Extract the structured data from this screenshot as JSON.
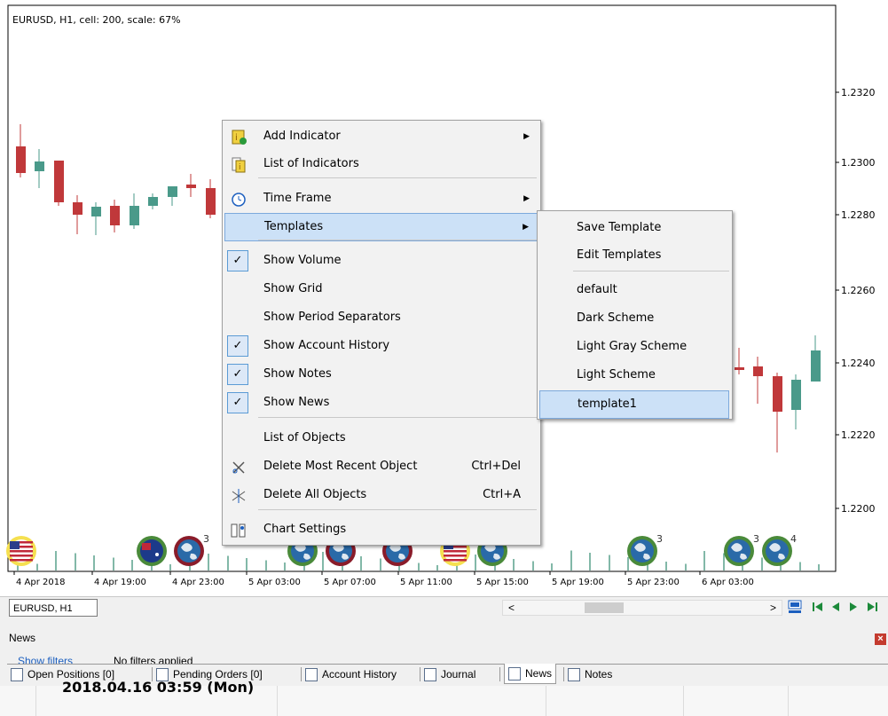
{
  "chart": {
    "info": "EURUSD, H1, cell: 200, scale: 67%",
    "price_labels": [
      "1.2320",
      "1.2300",
      "1.2280",
      "1.2260",
      "1.2240",
      "1.2220",
      "1.2200"
    ],
    "time_labels": [
      "4 Apr 2018",
      "4 Apr 19:00",
      "4 Apr 23:00",
      "5 Apr 03:00",
      "5 Apr 07:00",
      "5 Apr 11:00",
      "5 Apr 15:00",
      "5 Apr 19:00",
      "5 Apr 23:00",
      "6 Apr 03:00"
    ],
    "colors": {
      "bull": "#4a9a8a",
      "bear": "#c0383a"
    },
    "event_icons": [
      "us-flag-icon",
      "au-flag-icon",
      "globe-icon",
      "globe-icon",
      "globe-icon",
      "globe-icon",
      "us-flag-icon",
      "globe-icon",
      "globe-icon",
      "globe-icon",
      "globe-icon"
    ],
    "event_counts": [
      "3",
      "3",
      "3",
      "4",
      "3"
    ]
  },
  "context_menu": {
    "items": [
      {
        "label": "Add Indicator",
        "submenu": true,
        "icon": "add-indicator-icon"
      },
      {
        "label": "List of Indicators",
        "icon": "indicator-list-icon"
      },
      {
        "label": "Time Frame",
        "submenu": true,
        "icon": "clock-icon"
      },
      {
        "label": "Templates",
        "submenu": true,
        "highlighted": true
      },
      {
        "label": "Show Volume",
        "checked": true
      },
      {
        "label": "Show Grid"
      },
      {
        "label": "Show Period Separators"
      },
      {
        "label": "Show Account History",
        "checked": true
      },
      {
        "label": "Show Notes",
        "checked": true
      },
      {
        "label": "Show News",
        "checked": true
      },
      {
        "label": "List of Objects"
      },
      {
        "label": "Delete Most Recent Object",
        "shortcut": "Ctrl+Del",
        "icon": "delete-object-icon"
      },
      {
        "label": "Delete All Objects",
        "shortcut": "Ctrl+A",
        "icon": "delete-all-objects-icon"
      },
      {
        "label": "Chart Settings",
        "icon": "chart-settings-icon"
      }
    ],
    "check_mark": "✓",
    "arrow": "▶"
  },
  "templates_submenu": {
    "items": [
      "Save Template",
      "Edit Templates",
      "default",
      "Dark Scheme",
      "Light Gray Scheme",
      "Light Scheme",
      "template1"
    ]
  },
  "symbol_tab": "EURUSD, H1",
  "scroll": {
    "left": "<",
    "right": ">"
  },
  "news_panel": {
    "title": "News",
    "close": "×",
    "filters_link": "Show filters",
    "filters_status": "No filters applied",
    "tabs": [
      "Open Positions [0]",
      "Pending Orders [0]",
      "Account History",
      "Journal",
      "News",
      "Notes"
    ],
    "date": "2018.04.16 03:59 (Mon)"
  }
}
